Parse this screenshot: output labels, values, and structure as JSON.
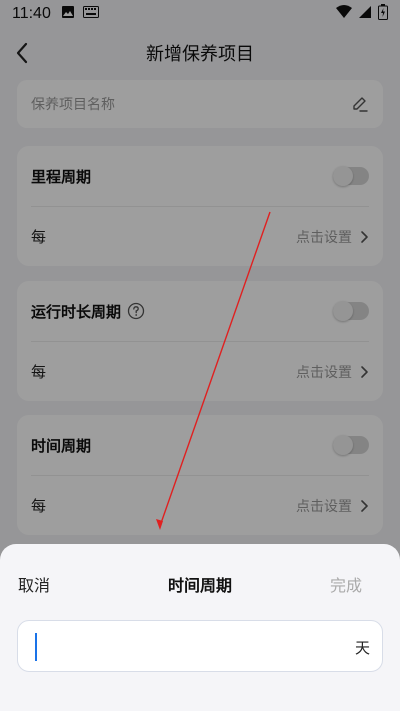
{
  "status_bar": {
    "time": "11:40"
  },
  "nav": {
    "title": "新增保养项目"
  },
  "name_field": {
    "placeholder": "保养项目名称"
  },
  "cards": [
    {
      "label": "里程周期",
      "every": "每",
      "set": "点击设置",
      "toggle_on": false,
      "has_help": false
    },
    {
      "label": "运行时长周期",
      "every": "每",
      "set": "点击设置",
      "toggle_on": false,
      "has_help": true
    },
    {
      "label": "时间周期",
      "every": "每",
      "set": "点击设置",
      "toggle_on": false,
      "has_help": false
    }
  ],
  "sheet": {
    "cancel": "取消",
    "title": "时间周期",
    "done": "完成",
    "input_value": "",
    "unit": "天"
  },
  "colors": {
    "accent": "#1a73e8",
    "annotation_arrow": "#e02020"
  }
}
